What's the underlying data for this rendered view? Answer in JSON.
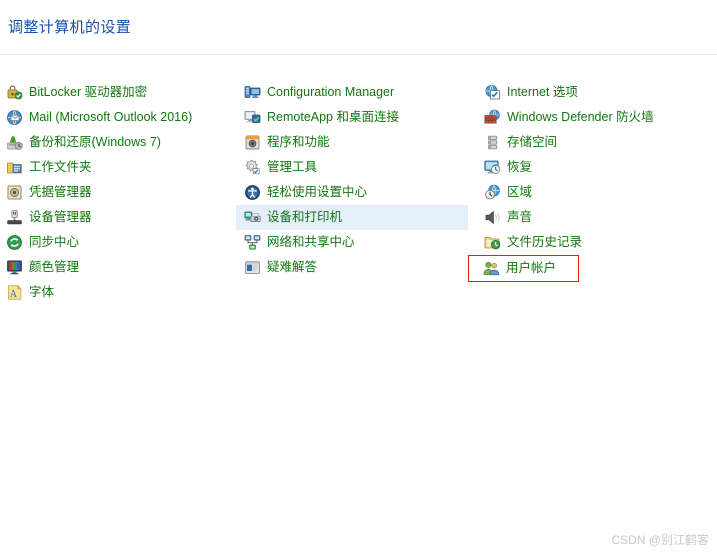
{
  "header": {
    "title": "调整计算机的设置",
    "title_color": "#1b4fa8"
  },
  "theme": {
    "link_color": "#12760f",
    "hover_background": "#e4effa",
    "highlight_box_border": "#e02020",
    "divider_color": "#e2ecf2",
    "page_background": "#ffffff"
  },
  "columns": [
    {
      "name": "column-1",
      "items": [
        {
          "label": "BitLocker 驱动器加密",
          "icon": "bitlocker-icon",
          "state": "normal"
        },
        {
          "label": "Mail (Microsoft Outlook 2016)",
          "icon": "mail-icon",
          "state": "normal"
        },
        {
          "label": "备份和还原(Windows 7)",
          "icon": "backup-restore-icon",
          "state": "normal"
        },
        {
          "label": "工作文件夹",
          "icon": "work-folders-icon",
          "state": "normal"
        },
        {
          "label": "凭据管理器",
          "icon": "credential-manager-icon",
          "state": "normal"
        },
        {
          "label": "设备管理器",
          "icon": "device-manager-icon",
          "state": "normal"
        },
        {
          "label": "同步中心",
          "icon": "sync-center-icon",
          "state": "normal"
        },
        {
          "label": "颜色管理",
          "icon": "color-management-icon",
          "state": "normal"
        },
        {
          "label": "字体",
          "icon": "fonts-icon",
          "state": "normal"
        }
      ]
    },
    {
      "name": "column-2",
      "items": [
        {
          "label": "Configuration Manager",
          "icon": "configuration-manager-icon",
          "state": "normal"
        },
        {
          "label": "RemoteApp 和桌面连接",
          "icon": "remoteapp-icon",
          "state": "normal"
        },
        {
          "label": "程序和功能",
          "icon": "programs-features-icon",
          "state": "normal"
        },
        {
          "label": "管理工具",
          "icon": "administrative-tools-icon",
          "state": "normal"
        },
        {
          "label": "轻松使用设置中心",
          "icon": "ease-of-access-icon",
          "state": "normal"
        },
        {
          "label": "设备和打印机",
          "icon": "devices-printers-icon",
          "state": "hovered"
        },
        {
          "label": "网络和共享中心",
          "icon": "network-sharing-icon",
          "state": "normal"
        },
        {
          "label": "疑难解答",
          "icon": "troubleshooting-icon",
          "state": "normal"
        }
      ]
    },
    {
      "name": "column-3",
      "items": [
        {
          "label": "Internet 选项",
          "icon": "internet-options-icon",
          "state": "normal"
        },
        {
          "label": "Windows Defender 防火墙",
          "icon": "windows-defender-firewall-icon",
          "state": "normal"
        },
        {
          "label": "存储空间",
          "icon": "storage-spaces-icon",
          "state": "normal"
        },
        {
          "label": "恢复",
          "icon": "recovery-icon",
          "state": "normal"
        },
        {
          "label": "区域",
          "icon": "region-icon",
          "state": "normal"
        },
        {
          "label": "声音",
          "icon": "sound-icon",
          "state": "normal"
        },
        {
          "label": "文件历史记录",
          "icon": "file-history-icon",
          "state": "normal"
        },
        {
          "label": "用户帐户",
          "icon": "user-accounts-icon",
          "state": "boxed"
        }
      ]
    }
  ],
  "watermark": {
    "text": "CSDN @别江鹤客"
  }
}
